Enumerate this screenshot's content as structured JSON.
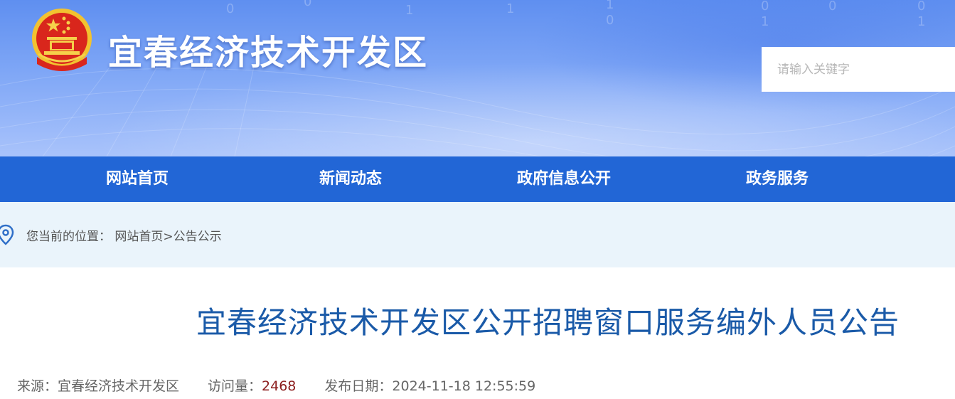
{
  "header": {
    "site_title": "宜春经济技术开发区",
    "search_placeholder": "请输入关键字"
  },
  "nav": {
    "items": [
      {
        "label": "网站首页"
      },
      {
        "label": "新闻动态"
      },
      {
        "label": "政府信息公开"
      },
      {
        "label": "政务服务"
      }
    ]
  },
  "breadcrumb": {
    "prefix": "您当前的位置：",
    "home": "网站首页",
    "separator": ">",
    "current": "公告公示"
  },
  "article": {
    "title": "宜春经济技术开发区公开招聘窗口服务编外人员公告",
    "source_label": "来源：",
    "source_value": "宜春经济技术开发区",
    "visits_label": "访问量：",
    "visits_value": "2468",
    "date_label": "发布日期：",
    "date_value": "2024-11-18 12:55:59"
  },
  "colors": {
    "nav_bg": "#2266d6",
    "title_blue": "#1a5aa8",
    "crumb_bg": "#eaf4fb",
    "visits_color": "#8b1c1c"
  },
  "icons": [
    "national-emblem-icon",
    "location-pin-icon"
  ]
}
